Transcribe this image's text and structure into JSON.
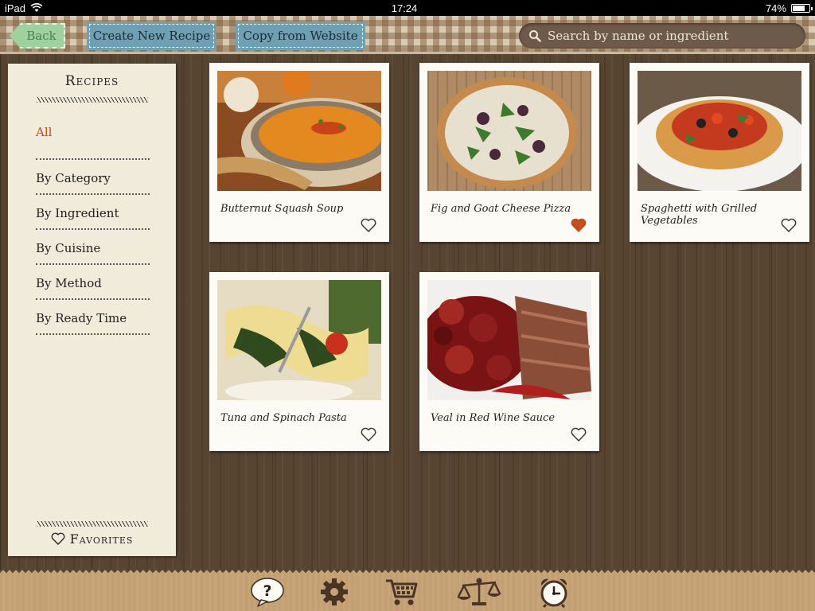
{
  "status": {
    "device": "iPad",
    "time": "17:24",
    "battery": "74%",
    "battery_level": 0.74
  },
  "toolbar": {
    "back_label": "Back",
    "create_label": "Create New Recipe",
    "copy_label": "Copy from Website",
    "search_placeholder": "Search by name or ingredient"
  },
  "sidebar": {
    "title": "Recipes",
    "items": [
      {
        "label": "All",
        "active": true
      },
      {
        "label": "By Category"
      },
      {
        "label": "By Ingredient"
      },
      {
        "label": "By Cuisine"
      },
      {
        "label": "By Method"
      },
      {
        "label": "By Ready Time"
      }
    ],
    "favorites_label": "Favorites"
  },
  "recipes": [
    {
      "title": "Butternut Squash Soup",
      "favorite": false
    },
    {
      "title": "Fig and Goat Cheese Pizza",
      "favorite": true
    },
    {
      "title": "Spaghetti with Grilled Vegetables",
      "favorite": false
    },
    {
      "title": "Tuna and Spinach Pasta",
      "favorite": false
    },
    {
      "title": "Veal in Red Wine Sauce",
      "favorite": false
    }
  ],
  "bottom_icons": [
    "help-icon",
    "gear-icon",
    "shopping-cart-icon",
    "scale-icon",
    "alarm-clock-icon"
  ],
  "colors": {
    "accent": "#c24d1e",
    "favorite_heart": "#c24d1e",
    "tool_button": "#6f9fb2",
    "back_button": "#9fd0a0"
  }
}
